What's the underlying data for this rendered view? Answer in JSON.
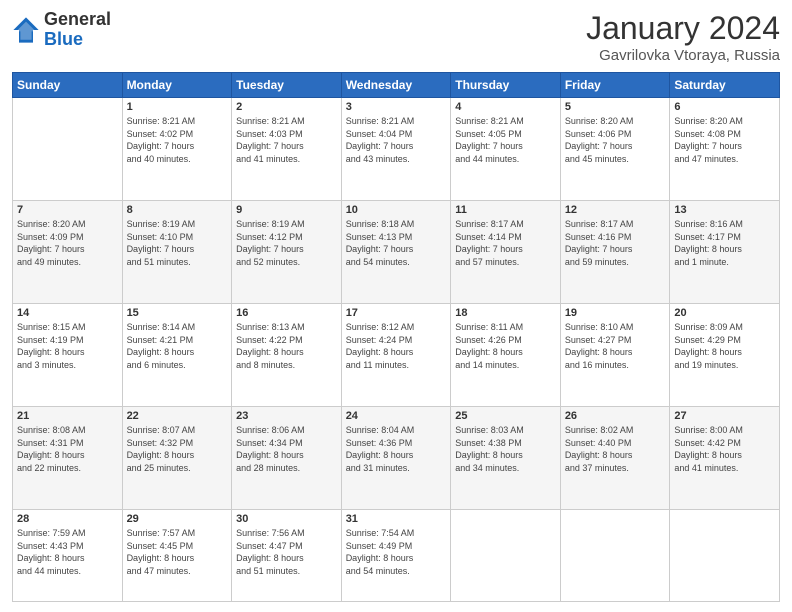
{
  "header": {
    "logo_general": "General",
    "logo_blue": "Blue",
    "month_title": "January 2024",
    "location": "Gavrilovka Vtoraya, Russia"
  },
  "days_of_week": [
    "Sunday",
    "Monday",
    "Tuesday",
    "Wednesday",
    "Thursday",
    "Friday",
    "Saturday"
  ],
  "weeks": [
    [
      {
        "day": "",
        "info": ""
      },
      {
        "day": "1",
        "info": "Sunrise: 8:21 AM\nSunset: 4:02 PM\nDaylight: 7 hours\nand 40 minutes."
      },
      {
        "day": "2",
        "info": "Sunrise: 8:21 AM\nSunset: 4:03 PM\nDaylight: 7 hours\nand 41 minutes."
      },
      {
        "day": "3",
        "info": "Sunrise: 8:21 AM\nSunset: 4:04 PM\nDaylight: 7 hours\nand 43 minutes."
      },
      {
        "day": "4",
        "info": "Sunrise: 8:21 AM\nSunset: 4:05 PM\nDaylight: 7 hours\nand 44 minutes."
      },
      {
        "day": "5",
        "info": "Sunrise: 8:20 AM\nSunset: 4:06 PM\nDaylight: 7 hours\nand 45 minutes."
      },
      {
        "day": "6",
        "info": "Sunrise: 8:20 AM\nSunset: 4:08 PM\nDaylight: 7 hours\nand 47 minutes."
      }
    ],
    [
      {
        "day": "7",
        "info": "Sunrise: 8:20 AM\nSunset: 4:09 PM\nDaylight: 7 hours\nand 49 minutes."
      },
      {
        "day": "8",
        "info": "Sunrise: 8:19 AM\nSunset: 4:10 PM\nDaylight: 7 hours\nand 51 minutes."
      },
      {
        "day": "9",
        "info": "Sunrise: 8:19 AM\nSunset: 4:12 PM\nDaylight: 7 hours\nand 52 minutes."
      },
      {
        "day": "10",
        "info": "Sunrise: 8:18 AM\nSunset: 4:13 PM\nDaylight: 7 hours\nand 54 minutes."
      },
      {
        "day": "11",
        "info": "Sunrise: 8:17 AM\nSunset: 4:14 PM\nDaylight: 7 hours\nand 57 minutes."
      },
      {
        "day": "12",
        "info": "Sunrise: 8:17 AM\nSunset: 4:16 PM\nDaylight: 7 hours\nand 59 minutes."
      },
      {
        "day": "13",
        "info": "Sunrise: 8:16 AM\nSunset: 4:17 PM\nDaylight: 8 hours\nand 1 minute."
      }
    ],
    [
      {
        "day": "14",
        "info": "Sunrise: 8:15 AM\nSunset: 4:19 PM\nDaylight: 8 hours\nand 3 minutes."
      },
      {
        "day": "15",
        "info": "Sunrise: 8:14 AM\nSunset: 4:21 PM\nDaylight: 8 hours\nand 6 minutes."
      },
      {
        "day": "16",
        "info": "Sunrise: 8:13 AM\nSunset: 4:22 PM\nDaylight: 8 hours\nand 8 minutes."
      },
      {
        "day": "17",
        "info": "Sunrise: 8:12 AM\nSunset: 4:24 PM\nDaylight: 8 hours\nand 11 minutes."
      },
      {
        "day": "18",
        "info": "Sunrise: 8:11 AM\nSunset: 4:26 PM\nDaylight: 8 hours\nand 14 minutes."
      },
      {
        "day": "19",
        "info": "Sunrise: 8:10 AM\nSunset: 4:27 PM\nDaylight: 8 hours\nand 16 minutes."
      },
      {
        "day": "20",
        "info": "Sunrise: 8:09 AM\nSunset: 4:29 PM\nDaylight: 8 hours\nand 19 minutes."
      }
    ],
    [
      {
        "day": "21",
        "info": "Sunrise: 8:08 AM\nSunset: 4:31 PM\nDaylight: 8 hours\nand 22 minutes."
      },
      {
        "day": "22",
        "info": "Sunrise: 8:07 AM\nSunset: 4:32 PM\nDaylight: 8 hours\nand 25 minutes."
      },
      {
        "day": "23",
        "info": "Sunrise: 8:06 AM\nSunset: 4:34 PM\nDaylight: 8 hours\nand 28 minutes."
      },
      {
        "day": "24",
        "info": "Sunrise: 8:04 AM\nSunset: 4:36 PM\nDaylight: 8 hours\nand 31 minutes."
      },
      {
        "day": "25",
        "info": "Sunrise: 8:03 AM\nSunset: 4:38 PM\nDaylight: 8 hours\nand 34 minutes."
      },
      {
        "day": "26",
        "info": "Sunrise: 8:02 AM\nSunset: 4:40 PM\nDaylight: 8 hours\nand 37 minutes."
      },
      {
        "day": "27",
        "info": "Sunrise: 8:00 AM\nSunset: 4:42 PM\nDaylight: 8 hours\nand 41 minutes."
      }
    ],
    [
      {
        "day": "28",
        "info": "Sunrise: 7:59 AM\nSunset: 4:43 PM\nDaylight: 8 hours\nand 44 minutes."
      },
      {
        "day": "29",
        "info": "Sunrise: 7:57 AM\nSunset: 4:45 PM\nDaylight: 8 hours\nand 47 minutes."
      },
      {
        "day": "30",
        "info": "Sunrise: 7:56 AM\nSunset: 4:47 PM\nDaylight: 8 hours\nand 51 minutes."
      },
      {
        "day": "31",
        "info": "Sunrise: 7:54 AM\nSunset: 4:49 PM\nDaylight: 8 hours\nand 54 minutes."
      },
      {
        "day": "",
        "info": ""
      },
      {
        "day": "",
        "info": ""
      },
      {
        "day": "",
        "info": ""
      }
    ]
  ]
}
